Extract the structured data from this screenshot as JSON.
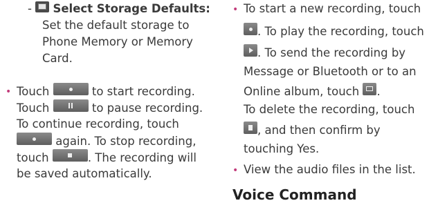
{
  "left_column": {
    "storage_item": {
      "dash": "-",
      "icon": "storage-card-icon",
      "title": "Select Storage Defaults:",
      "lines": [
        "Set the default storage to",
        "Phone Memory or Memory",
        "Card."
      ]
    },
    "record_item": {
      "bullet": "•",
      "line1_a": "Touch",
      "line1_b": "to start recording.",
      "line2_a": "Touch",
      "line2_b": "to pause recording.",
      "line3": "To continue recording, touch",
      "line4_b": "again. To stop recording,",
      "line5_a": "touch",
      "line5_b": ". The recording will",
      "line6": "be saved automatically."
    }
  },
  "right_column": {
    "playback_item": {
      "bullet": "•",
      "line1": "To start a new recording, touch",
      "line2_b": ". To play the recording, touch",
      "line3_b": ". To send the recording by",
      "line4": "Message or Bluetooth or to an",
      "line5_a": "Online album, touch",
      "line5_b": ".",
      "line6": "To delete the recording, touch",
      "line7_b": ", and then confirm by",
      "line8": "touching Yes."
    },
    "view_item": {
      "bullet": "•",
      "text": "View the audio files in the list."
    },
    "section_heading": "Voice Command"
  },
  "icons": {
    "record": "record-dot-icon",
    "pause": "pause-icon",
    "stop": "stop-square-icon",
    "play": "play-triangle-icon",
    "send": "envelope-icon",
    "delete": "trash-icon"
  },
  "colors": {
    "bullet": "#c23b7a",
    "text": "#3a3a3a",
    "icon_bg": "#6e6e6e"
  }
}
